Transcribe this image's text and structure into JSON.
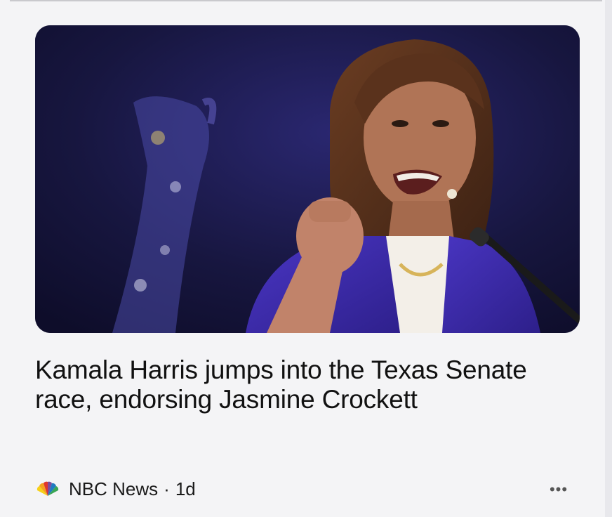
{
  "article": {
    "headline": "Kamala Harris jumps into the Texas Senate race, endorsing Jasmine Crockett",
    "source": "NBC News",
    "separator": "·",
    "age": "1d",
    "more_label": "•••",
    "image_icon": "photo-of-speaker-at-podium"
  },
  "colors": {
    "background": "#f4f4f6",
    "headline": "#111111",
    "meta": "#1a1a1a"
  }
}
